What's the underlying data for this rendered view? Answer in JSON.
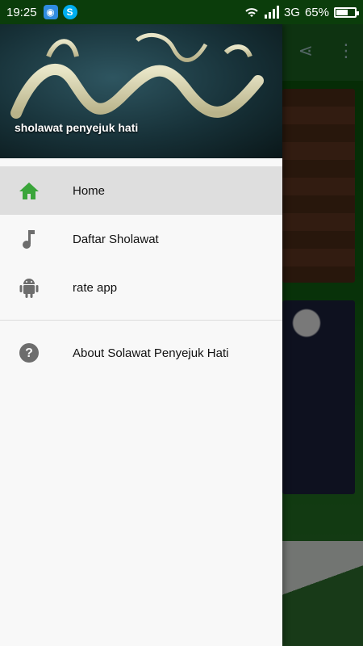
{
  "status_bar": {
    "time": "19:25",
    "network": "3G",
    "battery_percent": "65%",
    "battery_level": 0.65
  },
  "drawer": {
    "header_title": "sholawat penyejuk hati",
    "accent_color": "#2e8b2e",
    "items": [
      {
        "label": "Home",
        "icon": "home-icon",
        "active": true
      },
      {
        "label": "Daftar Sholawat",
        "icon": "music-note-icon",
        "active": false
      },
      {
        "label": "rate app",
        "icon": "android-icon",
        "active": false
      }
    ],
    "secondary_items": [
      {
        "label": "About Solawat Penyejuk Hati",
        "icon": "help-circle-icon"
      }
    ]
  }
}
